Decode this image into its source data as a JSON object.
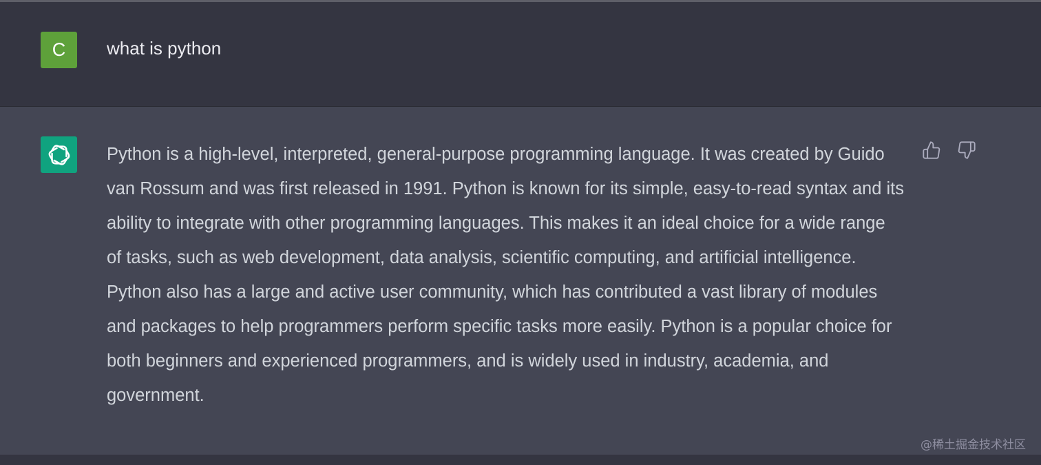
{
  "user_message": {
    "avatar_letter": "C",
    "avatar_color": "#5ea13a",
    "text": "what is python"
  },
  "assistant_message": {
    "avatar_icon": "openai-logo-icon",
    "avatar_color": "#10a37f",
    "text": "Python is a high-level, interpreted, general-purpose programming language. It was created by Guido van Rossum and was first released in 1991. Python is known for its simple, easy-to-read syntax and its ability to integrate with other programming languages. This makes it an ideal choice for a wide range of tasks, such as web development, data analysis, scientific computing, and artificial intelligence. Python also has a large and active user community, which has contributed a vast library of modules and packages to help programmers perform specific tasks more easily. Python is a popular choice for both beginners and experienced programmers, and is widely used in industry, academia, and government."
  },
  "feedback": {
    "thumbs_up_icon": "thumbs-up-icon",
    "thumbs_down_icon": "thumbs-down-icon"
  },
  "watermark": "@稀土掘金技术社区"
}
